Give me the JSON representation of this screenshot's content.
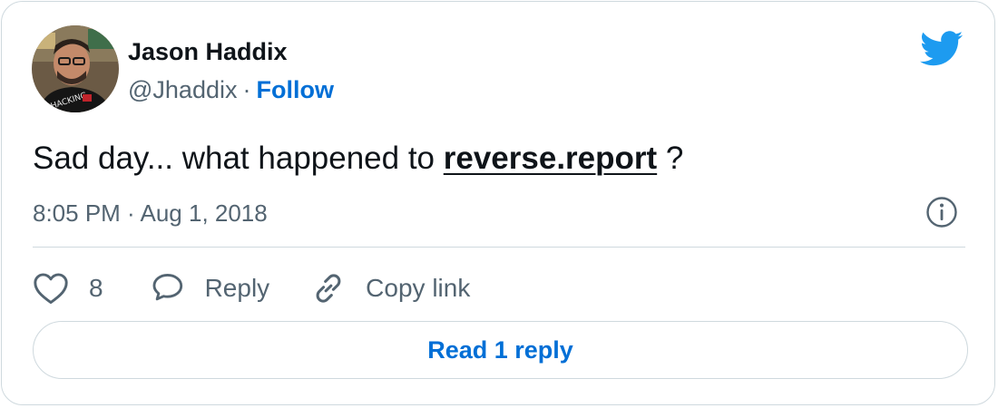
{
  "author": {
    "name": "Jason Haddix",
    "handle": "@Jhaddix",
    "separator": "·",
    "follow_label": "Follow",
    "avatar_shirt_text": "HACKING"
  },
  "tweet": {
    "text_before": "Sad day... what happened to ",
    "link_text": "reverse.report",
    "text_after": " ?",
    "timestamp": "8:05 PM · Aug 1, 2018"
  },
  "actions": {
    "like_count": "8",
    "reply_label": "Reply",
    "copy_link_label": "Copy link"
  },
  "read_replies_label": "Read 1 reply",
  "icons": {
    "brand": "twitter-bird-icon",
    "info": "info-icon",
    "like": "heart-icon",
    "reply": "speech-bubble-icon",
    "copy": "link-icon"
  },
  "colors": {
    "accent": "#006fd6",
    "bird": "#1d9bf0",
    "text": "#0f1419",
    "muted": "#536471",
    "border": "#cfd9de"
  }
}
